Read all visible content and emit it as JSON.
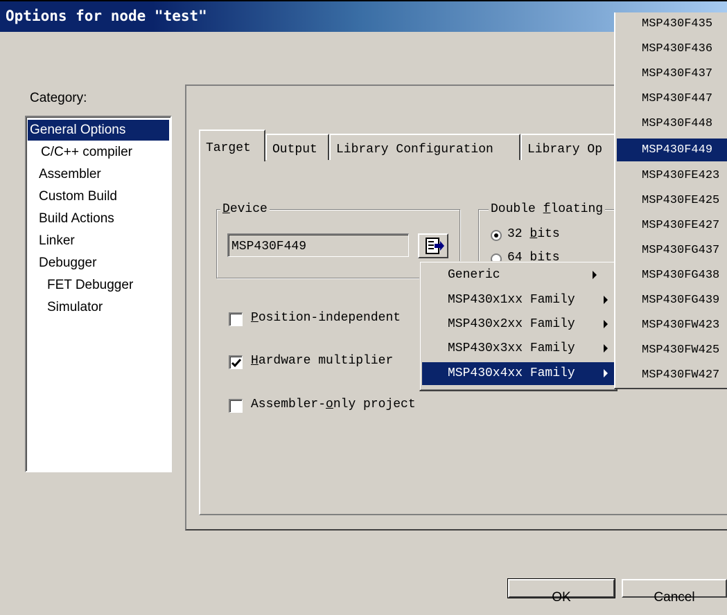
{
  "window": {
    "title": "Options for node \"test\""
  },
  "category": {
    "label": "Category:",
    "items": [
      {
        "label": "General Options",
        "selected": true
      },
      {
        "label": "C/C++ compiler"
      },
      {
        "label": "Assembler"
      },
      {
        "label": "Custom Build"
      },
      {
        "label": "Build Actions"
      },
      {
        "label": "Linker"
      },
      {
        "label": "Debugger"
      },
      {
        "label": "FET Debugger"
      },
      {
        "label": "Simulator"
      }
    ]
  },
  "tabs": [
    {
      "label": "Target",
      "active": true
    },
    {
      "label": "Output"
    },
    {
      "label": "Library Configuration"
    },
    {
      "label": "Library Op"
    }
  ],
  "device": {
    "group_title_u": "D",
    "group_title_rest": "evice",
    "value": "MSP430F449"
  },
  "double_floating": {
    "title_pre": "Double ",
    "title_u": "f",
    "title_rest": "loating",
    "option_32_pre": "32 ",
    "option_32_u": "b",
    "option_32_rest": "its",
    "option_64": "64 bits"
  },
  "checkboxes": {
    "position_independent": {
      "u": "P",
      "rest": "osition-independent",
      "checked": false
    },
    "hardware_multiplier": {
      "u": "H",
      "rest": "ardware multiplier",
      "checked": true
    },
    "assembler_only": {
      "pre": "Assembler-",
      "u": "o",
      "rest": "nly project",
      "checked": false
    }
  },
  "family_menu": [
    {
      "label": "Generic"
    },
    {
      "label": "MSP430x1xx Family"
    },
    {
      "label": "MSP430x2xx Family"
    },
    {
      "label": "MSP430x3xx Family"
    },
    {
      "label": "MSP430x4xx Family",
      "highlighted": true
    }
  ],
  "device_menu": [
    {
      "label": "MSP430F435"
    },
    {
      "label": "MSP430F436"
    },
    {
      "label": "MSP430F437"
    },
    {
      "label": "MSP430F447"
    },
    {
      "label": "MSP430F448"
    },
    {
      "label": "MSP430F449",
      "highlighted": true
    },
    {
      "label": "MSP430FE423"
    },
    {
      "label": "MSP430FE425"
    },
    {
      "label": "MSP430FE427"
    },
    {
      "label": "MSP430FG437"
    },
    {
      "label": "MSP430FG438"
    },
    {
      "label": "MSP430FG439"
    },
    {
      "label": "MSP430FW423"
    },
    {
      "label": "MSP430FW425"
    },
    {
      "label": "MSP430FW427"
    }
  ],
  "buttons": {
    "ok": "OK",
    "cancel": "Cancel"
  },
  "colors": {
    "selection": "#0a246a",
    "face": "#d4d0c8"
  }
}
